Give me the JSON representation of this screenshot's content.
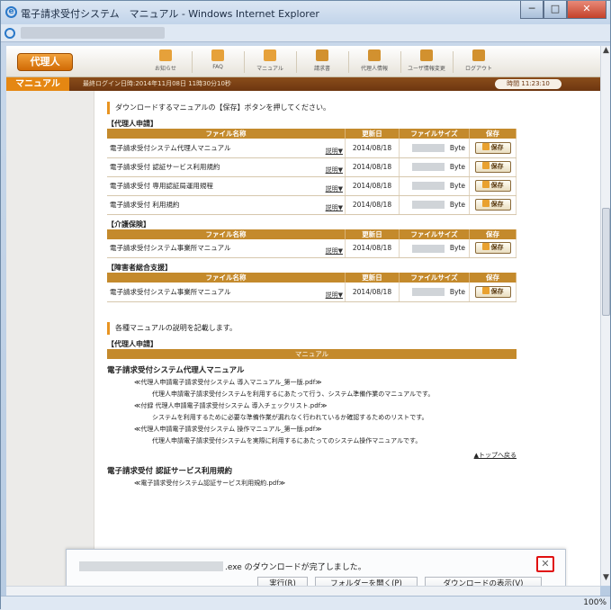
{
  "window": {
    "title": "電子請求受付システム　マニュアル - Windows Internet Explorer",
    "min": "─",
    "max": "□",
    "close": "✕"
  },
  "header": {
    "agent_label": "代理人",
    "nav": [
      {
        "label": "お知らせ",
        "color": "#e6a13a"
      },
      {
        "label": "FAQ",
        "color": "#e6a13a"
      },
      {
        "label": "マニュアル",
        "color": "#e6a13a"
      },
      {
        "label": "請求書",
        "color": "#d2912f"
      },
      {
        "label": "代理人情報",
        "color": "#d2912f"
      },
      {
        "label": "ユーザ情報変更",
        "color": "#d2912f"
      },
      {
        "label": "ログアウト",
        "color": "#d2912f"
      }
    ]
  },
  "subbar": {
    "tab": "マニュアル",
    "last_login": "最終ログイン日時:2014年11月08日 11時30分10秒",
    "time": "時間 11:23:10"
  },
  "notice1": "ダウンロードするマニュアルの【保存】ボタンを押してください。",
  "tables": [
    {
      "section": "【代理人申請】",
      "headers": [
        "ファイル名称",
        "更新日",
        "ファイルサイズ",
        "保存"
      ],
      "rows": [
        {
          "name": "電子請求受付システム代理人マニュアル",
          "desc": "説明▼",
          "date": "2014/08/18",
          "unit": "Byte",
          "save": "保存"
        },
        {
          "name": "電子請求受付 認証サービス利用規約",
          "desc": "説明▼",
          "date": "2014/08/18",
          "unit": "Byte",
          "save": "保存"
        },
        {
          "name": "電子請求受付 専用認証局運用規程",
          "desc": "説明▼",
          "date": "2014/08/18",
          "unit": "Byte",
          "save": "保存"
        },
        {
          "name": "電子請求受付 利用規約",
          "desc": "説明▼",
          "date": "2014/08/18",
          "unit": "Byte",
          "save": "保存"
        }
      ]
    },
    {
      "section": "【介護保険】",
      "headers": [
        "ファイル名称",
        "更新日",
        "ファイルサイズ",
        "保存"
      ],
      "rows": [
        {
          "name": "電子請求受付システム事業所マニュアル",
          "desc": "説明▼",
          "date": "2014/08/18",
          "unit": "Byte",
          "save": "保存"
        }
      ]
    },
    {
      "section": "【障害者総合支援】",
      "headers": [
        "ファイル名称",
        "更新日",
        "ファイルサイズ",
        "保存"
      ],
      "rows": [
        {
          "name": "電子請求受付システム事業所マニュアル",
          "desc": "説明▼",
          "date": "2014/08/18",
          "unit": "Byte",
          "save": "保存"
        }
      ]
    }
  ],
  "notice2": "各種マニュアルの説明を記載します。",
  "manual": {
    "section": "【代理人申請】",
    "head": "マニュアル",
    "title1": "電子請求受付システム代理人マニュアル",
    "lines": [
      "≪代理人申請電子請求受付システム 導入マニュアル_第一版.pdf≫",
      "代理人申請電子請求受付システムを利用するにあたって行う、システム準備作業のマニュアルです。",
      "≪付録 代理人申請電子請求受付システム 導入チェックリスト.pdf≫",
      "システムを利用するために必要な準備作業が漏れなく行われているか確認するためのリストです。",
      "≪代理人申請電子請求受付システム 操作マニュアル_第一版.pdf≫",
      "代理人申請電子請求受付システムを実際に利用するにあたってのシステム操作マニュアルです。"
    ],
    "totop": "▲トップへ戻る",
    "title2": "電子請求受付 認証サービス利用規約",
    "line_last": "≪電子請求受付システム認証サービス利用規約.pdf≫"
  },
  "download": {
    "message": ".exe のダウンロードが完了しました。",
    "run": "実行(R)",
    "open_folder": "フォルダーを開く(P)",
    "show": "ダウンロードの表示(V)",
    "close": "✕"
  },
  "status": {
    "zoom": "100%"
  }
}
